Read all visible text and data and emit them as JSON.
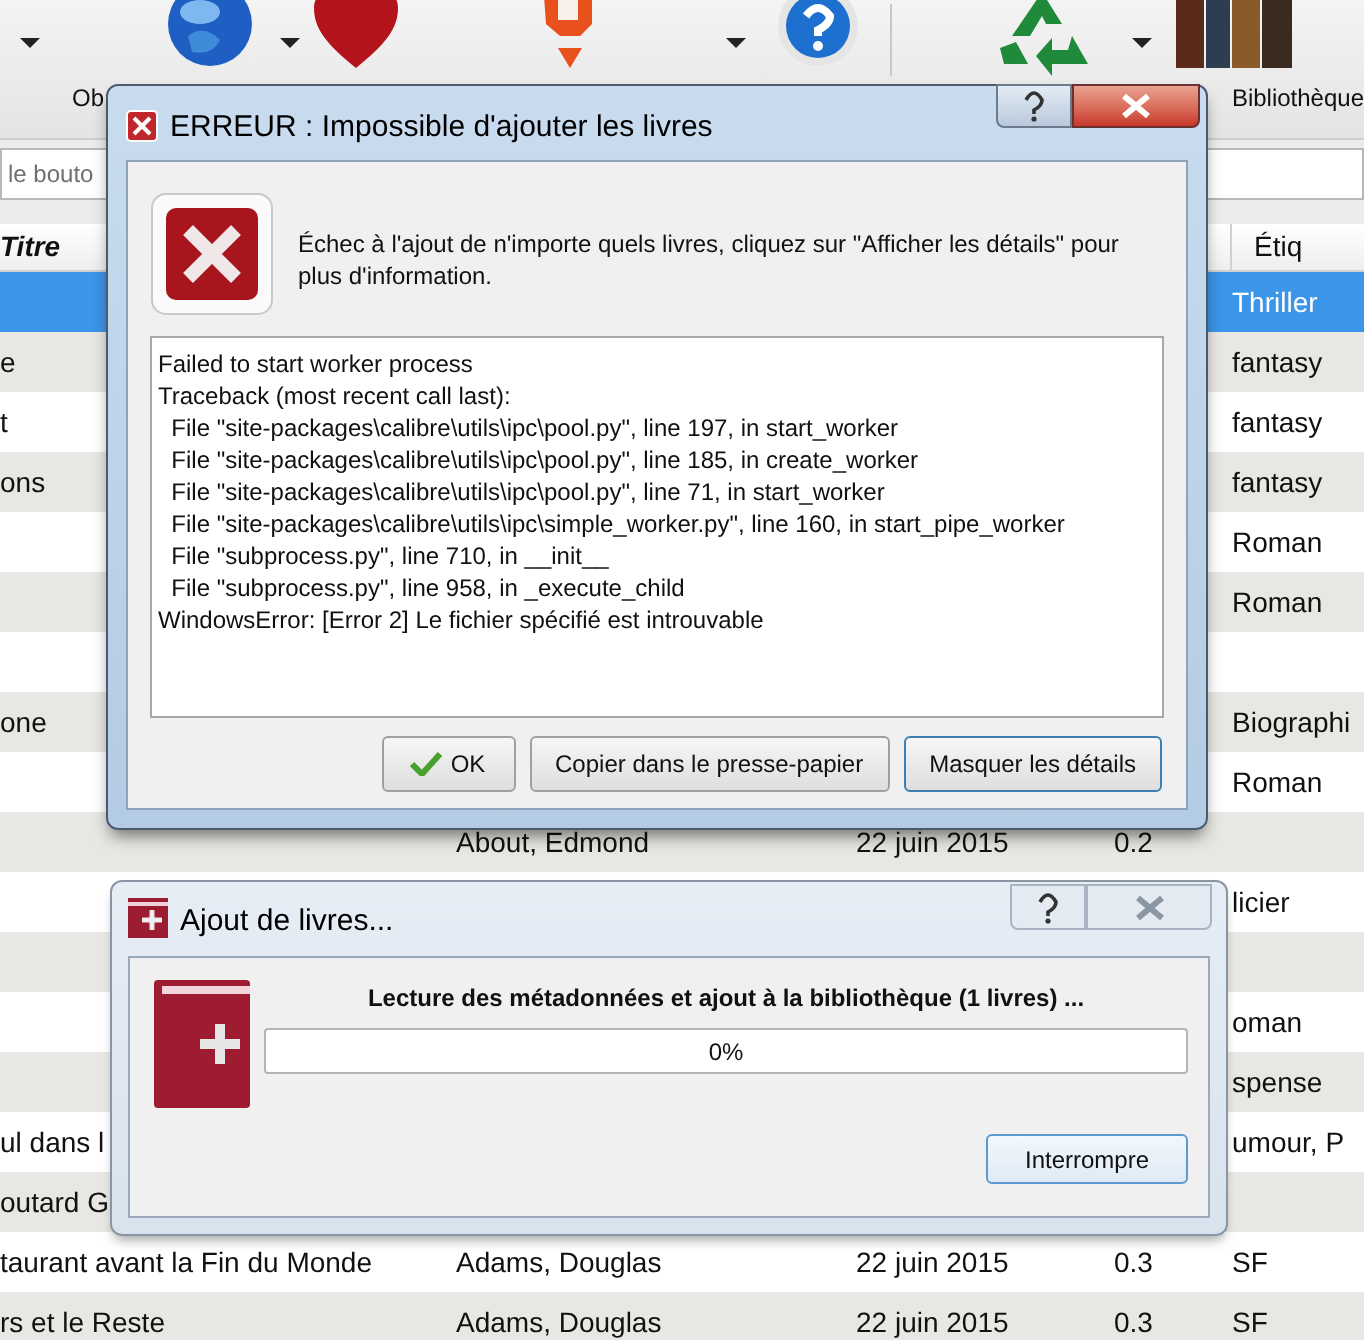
{
  "toolbar": {
    "labels": [
      "Ob",
      "Bibliothèque"
    ]
  },
  "search": {
    "placeholder": "le bouto"
  },
  "table": {
    "columns": [
      {
        "label": "Titre"
      },
      {
        "label": "Étiq"
      }
    ],
    "rows": [
      {
        "selected": true,
        "tags": "Thriller"
      },
      {
        "selected": false,
        "title": "e",
        "tags": "fantasy"
      },
      {
        "selected": false,
        "title": "t",
        "tags": "fantasy"
      },
      {
        "selected": false,
        "title": "ons",
        "tags": "fantasy"
      },
      {
        "selected": false,
        "tags": "Roman"
      },
      {
        "selected": false,
        "tags": "Roman"
      },
      {
        "selected": false
      },
      {
        "selected": false,
        "title": "one",
        "tags": "Biographi"
      },
      {
        "selected": false,
        "tags": "Roman"
      },
      {
        "selected": false,
        "author": "About, Edmond",
        "date": "22 juin 2015",
        "size": "0.2"
      },
      {
        "selected": false,
        "tags": "licier"
      },
      {
        "selected": false
      },
      {
        "selected": false,
        "tags": "oman"
      },
      {
        "selected": false,
        "tags": "spense"
      },
      {
        "selected": false,
        "title": "ul dans l",
        "tags": "umour, P"
      },
      {
        "selected": false,
        "title": "outard G"
      },
      {
        "selected": false,
        "title": "taurant avant la Fin du Monde",
        "author": "Adams, Douglas",
        "date": "22 juin 2015",
        "size": "0.3",
        "tags": "SF"
      },
      {
        "selected": false,
        "title": "rs et le Reste",
        "author": "Adams, Douglas",
        "date": "22 juin 2015",
        "size": "0.3",
        "tags": "SF"
      }
    ]
  },
  "error_dialog": {
    "title": "ERREUR : Impossible d'ajouter les livres",
    "message": "Échec à l'ajout de n'importe quels livres, cliquez sur \"Afficher les détails\" pour plus d'information.",
    "details": [
      "Failed to start worker process",
      "Traceback (most recent call last):",
      "  File \"site-packages\\calibre\\utils\\ipc\\pool.py\", line 197, in start_worker",
      "  File \"site-packages\\calibre\\utils\\ipc\\pool.py\", line 185, in create_worker",
      "  File \"site-packages\\calibre\\utils\\ipc\\pool.py\", line 71, in start_worker",
      "  File \"site-packages\\calibre\\utils\\ipc\\simple_worker.py\", line 160, in start_pipe_worker",
      "  File \"subprocess.py\", line 710, in __init__",
      "  File \"subprocess.py\", line 958, in _execute_child",
      "WindowsError: [Error 2] Le fichier spécifié est introuvable"
    ],
    "buttons": [
      {
        "label": "OK",
        "kind": "ok",
        "default": false
      },
      {
        "label": "Copier dans le presse-papier",
        "kind": "plain",
        "default": false
      },
      {
        "label": "Masquer les détails",
        "kind": "plain",
        "default": true
      }
    ]
  },
  "progress_dialog": {
    "title": "Ajout de livres...",
    "status": "Lecture des métadonnées et ajout à la bibliothèque (1 livres) ...",
    "progress": {
      "level": 0,
      "reading": "0%"
    },
    "buttons": [
      {
        "label": "Interrompre",
        "default": true
      }
    ]
  }
}
